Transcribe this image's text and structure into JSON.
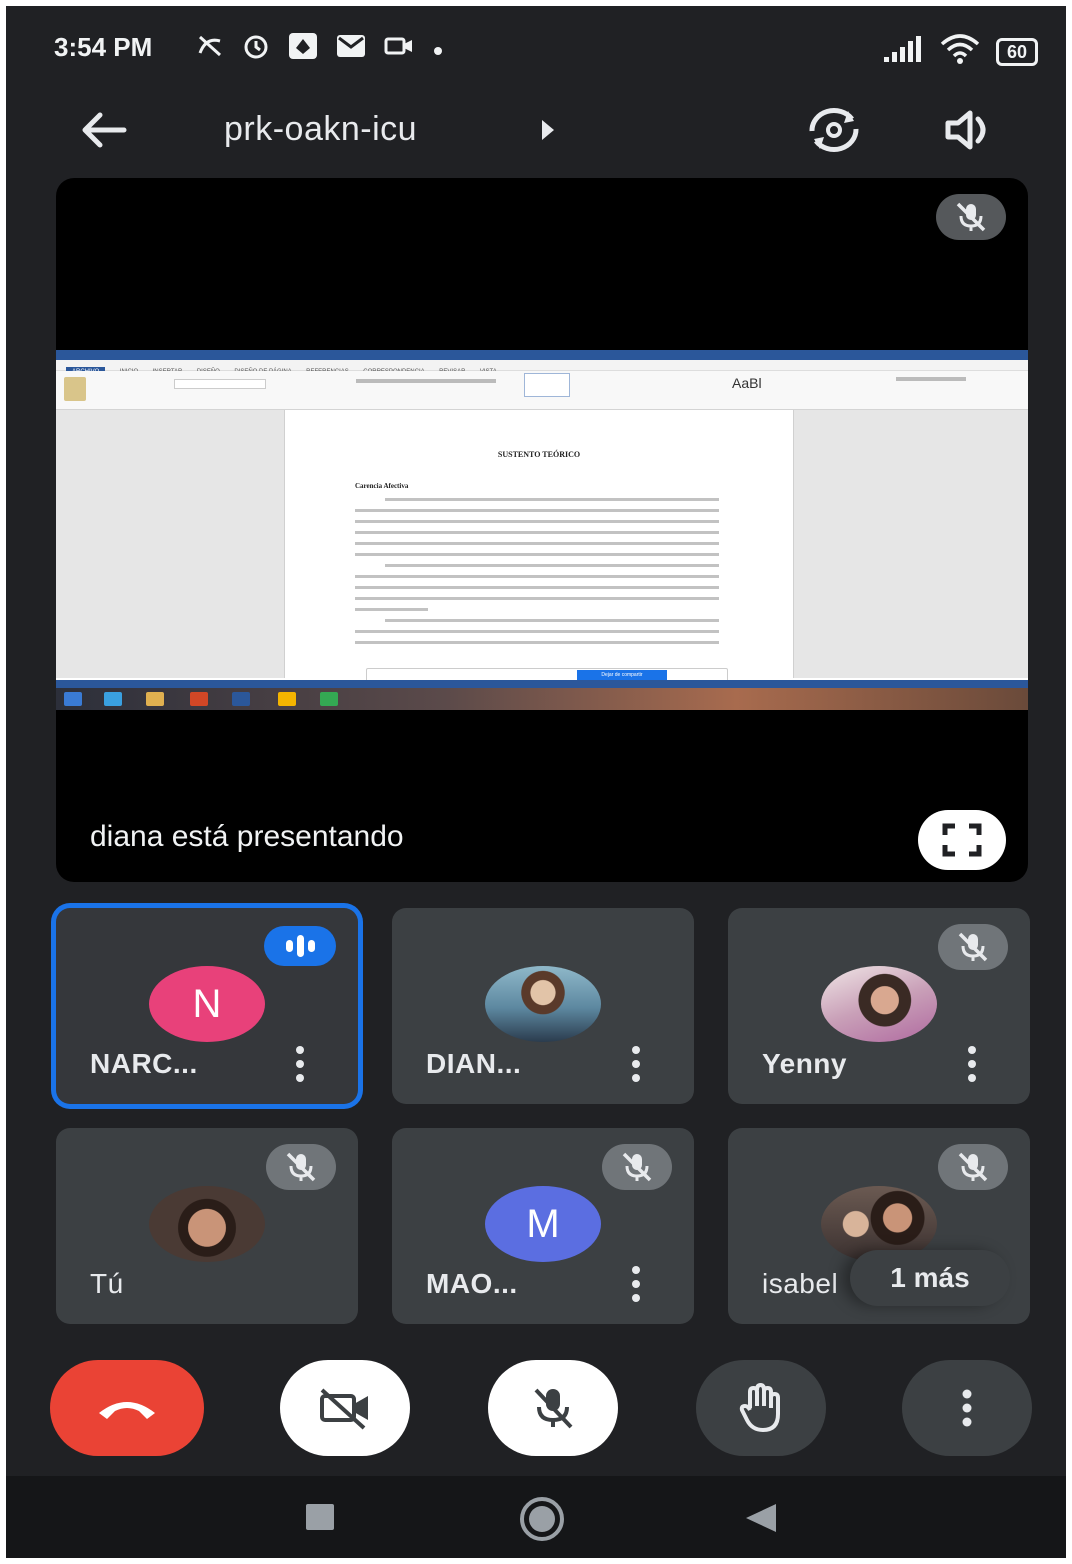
{
  "status_bar": {
    "time": "3:54 PM",
    "battery": "60",
    "icons": [
      "no-sync-icon",
      "alarm-icon",
      "app-icon",
      "gmail-icon",
      "camera-icon",
      "dot-icon",
      "signal-icon",
      "wifi-icon",
      "battery-icon"
    ]
  },
  "header": {
    "meeting_code": "prk-oakn-icu",
    "icons": [
      "back-arrow-icon",
      "switch-camera-icon",
      "speaker-icon"
    ]
  },
  "presentation": {
    "presenter_text": "diana está presentando",
    "doc_heading": "SUSTENTO TEÓRICO",
    "doc_subheading": "Carencia Afectiva",
    "word_tabs": [
      "ARCHIVO",
      "INICIO",
      "INSERTAR",
      "DISEÑO",
      "DISEÑO DE PÁGINA",
      "REFERENCIAS",
      "CORRESPONDENCIA",
      "REVISAR",
      "VISTA"
    ],
    "style_sample": "AaBl",
    "share_stop_label": "Dejar de compartir"
  },
  "participants": [
    {
      "name": "NARC...",
      "initial": "N",
      "avatar_color": "#e8417a",
      "speaking": true,
      "muted": false
    },
    {
      "name": "DIAN...",
      "photo": true,
      "muted": false
    },
    {
      "name": "Yenny",
      "photo": true,
      "muted": true
    },
    {
      "name": "Tú",
      "photo": true,
      "muted": true
    },
    {
      "name": "MAO...",
      "initial": "M",
      "avatar_color": "#5b6ee1",
      "muted": true
    },
    {
      "name": "isabel",
      "photo": true,
      "muted": true,
      "overflow_label": "1 más"
    }
  ],
  "controls": {
    "end_call_color": "#ea4335",
    "icons": [
      "end-call-icon",
      "camera-off-icon",
      "mic-off-icon",
      "raise-hand-icon",
      "more-options-icon"
    ]
  },
  "colors": {
    "background": "#202124",
    "tile": "#3c4043",
    "accent": "#1a73e8"
  }
}
